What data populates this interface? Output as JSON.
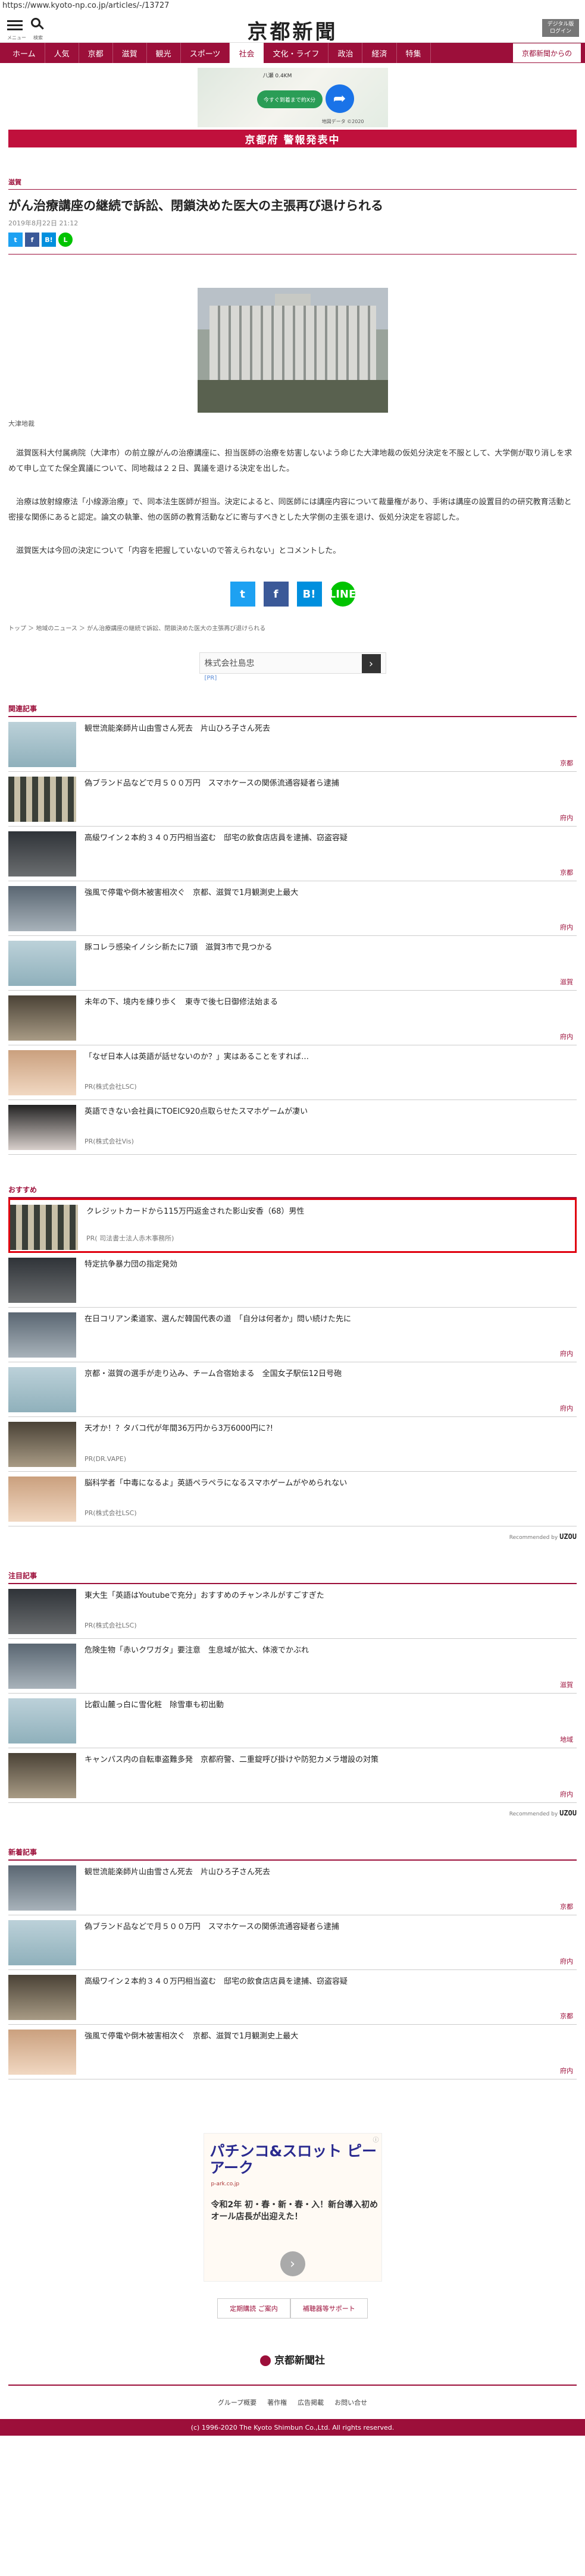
{
  "url": "https://www.kyoto-np.co.jp/articles/-/13727",
  "header": {
    "menu_label": "メニュー",
    "search_label": "検索",
    "logo": "京都新聞",
    "digital_label": "デジタル版\nログイン"
  },
  "nav": [
    "ホーム",
    "人気",
    "京都",
    "滋賀",
    "観光",
    "スポーツ",
    "社会",
    "文化・ライフ",
    "政治",
    "経済",
    "特集"
  ],
  "nav_special": "京都新聞からの",
  "map_ad": {
    "location": "八瀬 0.4KM",
    "pill": "今すぐ到着まで約X分",
    "caption": "地図データ ©2020"
  },
  "alert": "京都府 警報発表中",
  "article": {
    "category": "滋賀",
    "title": "がん治療講座の継続で訴訟、閉鎖決めた医大の主張再び退けられる",
    "date": "2019年8月22日 21:12",
    "caption": "大津地裁",
    "paragraphs": [
      "滋賀医科大付属病院（大津市）の前立腺がんの治療講座に、担当医師の治療を妨害しないよう命じた大津地裁の仮処分決定を不服として、大学側が取り消しを求めて申し立てた保全異議について、同地裁は２２日、異議を退ける決定を出した。",
      "治療は放射線療法「小線源治療」で、同本法生医師が担当。決定によると、同医師には講座内容について裁量権があり、手術は講座の設置目的の研究教育活動と密接な関係にあると認定。論文の執筆、他の医師の教育活動などに寄与すべきとした大学側の主張を退け、仮処分決定を容認した。",
      "滋賀医大は今回の決定について「内容を把握していないので答えられない」とコメントした。"
    ],
    "breadcrumb": "トップ ＞ 地域のニュース ＞ がん治療講座の継続で訴訟、閉鎖決めた医大の主張再び退けられる"
  },
  "text_ad": {
    "text": "株式会社島忠",
    "marker": "[PR]"
  },
  "sections": {
    "related": {
      "title": "関連記事",
      "items": [
        {
          "title": "観世流能楽師片山由雪さん死去　片山ひろ子さん死去",
          "tag": "京都",
          "pr": ""
        },
        {
          "title": "偽ブランド品などで月５００万円　スマホケースの関係流通容疑者ら逮捕",
          "tag": "府内",
          "pr": ""
        },
        {
          "title": "高級ワイン２本約３４０万円相当盗む　邸宅の飲食店店員を逮捕、窃盗容疑",
          "tag": "京都",
          "pr": ""
        },
        {
          "title": "強風で停電や倒木被害相次ぐ　京都、滋賀で1月観測史上最大",
          "tag": "府内",
          "pr": ""
        },
        {
          "title": "豚コレラ感染イノシシ新たに7頭　滋賀3市で見つかる",
          "tag": "滋賀",
          "pr": ""
        },
        {
          "title": "未年の下、境内を練り歩く　東寺で後七日御修法始まる",
          "tag": "府内",
          "pr": ""
        },
        {
          "title": "「なぜ日本人は英語が話せないのか？」実はあることをすれば…",
          "tag": "",
          "pr": "PR(株式会社LSC)"
        },
        {
          "title": "英語できない会社員にTOEIC920点取らせたスマホゲームが凄い",
          "tag": "",
          "pr": "PR(株式会社Vis)"
        }
      ]
    },
    "recommended": {
      "title": "おすすめ",
      "items": [
        {
          "title": "クレジットカードから115万円返金された影山安香（68）男性",
          "tag": "",
          "pr": "PR( 司法書士法人赤木事務所)",
          "highlight": true
        },
        {
          "title": "特定抗争暴力団の指定発効",
          "tag": "",
          "pr": ""
        },
        {
          "title": "在日コリアン柔道家、選んだ韓国代表の道　「自分は何者か」問い続けた先に",
          "tag": "府内",
          "pr": ""
        },
        {
          "title": "京都・滋賀の選手が走り込み、チーム合宿始まる　全国女子駅伝12日号砲",
          "tag": "府内",
          "pr": ""
        },
        {
          "title": "天才か！？タバコ代が年間36万円から3万6000円に?!",
          "tag": "",
          "pr": "PR(DR.VAPE)"
        },
        {
          "title": "脳科学者「中毒になるよ」英語ペラペラになるスマホゲームがやめられない",
          "tag": "",
          "pr": "PR(株式会社LSC)"
        }
      ],
      "rec_by": "Recommended by",
      "rec_logo": "UZOU"
    },
    "featured": {
      "title": "注目記事",
      "items": [
        {
          "title": "東大生「英語はYoutubeで充分」おすすめのチャンネルがすごすぎた",
          "tag": "",
          "pr": "PR(株式会社LSC)"
        },
        {
          "title": "危険生物「赤いクワガタ」要注意　生息域が拡大、体液でかぶれ",
          "tag": "滋賀",
          "pr": ""
        },
        {
          "title": "比叡山麓っ白に雪化粧　除雪車も初出動",
          "tag": "地域",
          "pr": ""
        },
        {
          "title": "キャンパス内の自転車盗難多発　京都府警、二重錠呼び掛けや防犯カメラ増設の対策",
          "tag": "府内",
          "pr": ""
        }
      ],
      "rec_by": "Recommended by",
      "rec_logo": "UZOU"
    },
    "latest": {
      "title": "新着記事",
      "items": [
        {
          "title": "観世流能楽師片山由雪さん死去　片山ひろ子さん死去",
          "tag": "京都",
          "pr": ""
        },
        {
          "title": "偽ブランド品などで月５００万円　スマホケースの関係流通容疑者ら逮捕",
          "tag": "府内",
          "pr": ""
        },
        {
          "title": "高級ワイン２本約３４０万円相当盗む　邸宅の飲食店店員を逮捕、窃盗容疑",
          "tag": "京都",
          "pr": ""
        },
        {
          "title": "強風で停電や倒木被害相次ぐ　京都、滋賀で1月観測史上最大",
          "tag": "府内",
          "pr": ""
        }
      ]
    }
  },
  "banner": {
    "headline": "パチンコ&スロット ピーアーク",
    "sub": "p-ark.co.jp",
    "body": "令和2年 初・春・新・春・入！新台導入初め オール店長が出迎えた！"
  },
  "footer": {
    "buttons": [
      "定期購読 ご案内",
      "補聴器等サポート"
    ],
    "logo": "京都新聞社",
    "links": [
      "グループ概要",
      "著作権",
      "広告掲載",
      "お問い合せ"
    ],
    "copyright": "(c) 1996-2020 The Kyoto Shimbun Co.,Ltd. All rights reserved."
  },
  "colors": {
    "brand": "#9c0f3a",
    "alert": "#c0103c",
    "pr_text": "#777777"
  }
}
